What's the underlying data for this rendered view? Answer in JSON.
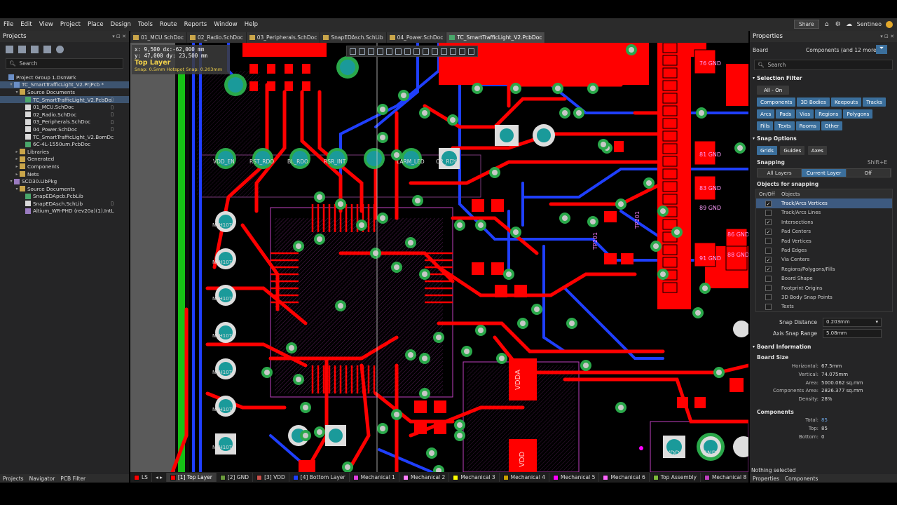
{
  "menubar": {
    "items": [
      "File",
      "Edit",
      "View",
      "Project",
      "Place",
      "Design",
      "Tools",
      "Route",
      "Reports",
      "Window",
      "Help"
    ],
    "share_label": "Share",
    "user": "Sentineo"
  },
  "projects_panel": {
    "title": "Projects",
    "search_placeholder": "Search",
    "tree": [
      {
        "label": "Project Group 1.DsnWrk",
        "icon": "proj",
        "indent": 0,
        "arrow": ""
      },
      {
        "label": "TC_SmartTrafficLight_V2.PrjPcb *",
        "icon": "proj",
        "indent": 1,
        "arrow": "▾",
        "sel": true
      },
      {
        "label": "Source Documents",
        "icon": "folder",
        "indent": 2,
        "arrow": "▾"
      },
      {
        "label": "TC_SmartTrafficLight_V2.PcbDo",
        "icon": "pcb",
        "indent": 3,
        "arrow": "",
        "sel": true,
        "doc": true
      },
      {
        "label": "01_MCU.SchDoc",
        "icon": "sch",
        "indent": 3,
        "arrow": "",
        "doc": true
      },
      {
        "label": "02_Radio.SchDoc",
        "icon": "sch",
        "indent": 3,
        "arrow": "",
        "doc": true
      },
      {
        "label": "03_Peripherals.SchDoc",
        "icon": "sch",
        "indent": 3,
        "arrow": "",
        "doc": true
      },
      {
        "label": "04_Power.SchDoc",
        "icon": "sch",
        "indent": 3,
        "arrow": "",
        "doc": true
      },
      {
        "label": "TC_SmartTrafficLight_V2.BomDc",
        "icon": "sch",
        "indent": 3,
        "arrow": ""
      },
      {
        "label": "6C-4L-1550um.PcbDoc",
        "icon": "pcb",
        "indent": 3,
        "arrow": ""
      },
      {
        "label": "Libraries",
        "icon": "folder",
        "indent": 2,
        "arrow": "▸"
      },
      {
        "label": "Generated",
        "icon": "folder",
        "indent": 2,
        "arrow": "▸"
      },
      {
        "label": "Components",
        "icon": "folder",
        "indent": 2,
        "arrow": "▸"
      },
      {
        "label": "Nets",
        "icon": "folder",
        "indent": 2,
        "arrow": "▸"
      },
      {
        "label": "SCD30.LibPkg",
        "icon": "lib",
        "indent": 1,
        "arrow": "▾"
      },
      {
        "label": "Source Documents",
        "icon": "folder",
        "indent": 2,
        "arrow": "▾"
      },
      {
        "label": "SnapEDApcb.PcbLib",
        "icon": "pcb",
        "indent": 3,
        "arrow": ""
      },
      {
        "label": "SnapEDAsch.SchLib",
        "icon": "sch",
        "indent": 3,
        "arrow": "",
        "doc": true
      },
      {
        "label": "Altium_WR-PHD (rev20a)(1).IntL",
        "icon": "lib",
        "indent": 3,
        "arrow": ""
      }
    ],
    "bottom_tabs": [
      "Projects",
      "Navigator",
      "PCB Filter"
    ]
  },
  "doc_tabs": [
    {
      "label": "01_MCU.SchDoc",
      "kind": "sch"
    },
    {
      "label": "02_Radio.SchDoc",
      "kind": "sch"
    },
    {
      "label": "03_Peripherals.SchDoc",
      "kind": "sch"
    },
    {
      "label": "SnapEDAsch.SchLib",
      "kind": "sch"
    },
    {
      "label": "04_Power.SchDoc",
      "kind": "sch"
    },
    {
      "label": "TC_SmartTrafficLight_V2.PcbDoc",
      "kind": "pcb",
      "active": true
    }
  ],
  "hud": {
    "line1": "x: 9,500  dx:-62,000 mm",
    "line2": "y: 47,000  dy: 23,500 mm",
    "layer": "Top Layer",
    "snap": "Snap: 0.5mm Hotspot Snap: 0.203mm"
  },
  "pcb_labels": {
    "pads_top": [
      "VDD_EN",
      "RST_RDO",
      "BL_RDO",
      "RSR_INT",
      "",
      "LARM_LED",
      "O2_RDY"
    ],
    "pads_left": [
      "NTH1077",
      "NTH1079",
      "NTH1078",
      "NTH1076",
      "NTH1075",
      "NTH1072",
      "NTH1074"
    ],
    "right_gnd": [
      "76 GND",
      "81 GND",
      "83 GND",
      "89 GND",
      "91 GND",
      "86 GND",
      "88 GND",
      "90 GND"
    ],
    "vdda": "VDDA",
    "vdd": "VDD",
    "conn": [
      "VDD",
      "GND"
    ],
    "tp": [
      "TP201",
      "TP201"
    ]
  },
  "layer_bar": [
    {
      "label": "[1] Top Layer",
      "color": "#ff0000",
      "active": true
    },
    {
      "label": "[2] GND",
      "color": "#6a9a3c"
    },
    {
      "label": "[3] VDD",
      "color": "#c9504a"
    },
    {
      "label": "[4] Bottom Layer",
      "color": "#1f3fff"
    },
    {
      "label": "Mechanical 1",
      "color": "#e040e0"
    },
    {
      "label": "Mechanical 2",
      "color": "#ff80ff"
    },
    {
      "label": "Mechanical 3",
      "color": "#ffff00"
    },
    {
      "label": "Mechanical 4",
      "color": "#c9a100"
    },
    {
      "label": "Mechanical 5",
      "color": "#ff00ff"
    },
    {
      "label": "Mechanical 6",
      "color": "#ff66ff"
    },
    {
      "label": "Top Assembly",
      "color": "#7dba3a"
    },
    {
      "label": "Mechanical 8",
      "color": "#c040c0"
    },
    {
      "label": "Mechanical 9",
      "color": "#ff40ff"
    }
  ],
  "layer_bar_ls": "LS",
  "properties": {
    "title": "Properties",
    "board_label": "Board",
    "board_value": "Components (and 12 more)",
    "search_placeholder": "Search",
    "selection_filter_title": "Selection Filter",
    "all_on": "All - On",
    "filter_chips": [
      "Components",
      "3D Bodies",
      "Keepouts",
      "Tracks",
      "Arcs",
      "Pads",
      "Vias",
      "Regions",
      "Polygons",
      "Fills",
      "Texts",
      "Rooms",
      "Other"
    ],
    "snap_options_title": "Snap Options",
    "snap_tabs": [
      "Grids",
      "Guides",
      "Axes"
    ],
    "snapping_label": "Snapping",
    "snapping_shortcut": "Shift+E",
    "snapping_modes": [
      "All Layers",
      "Current Layer",
      "Off"
    ],
    "objects_for_snapping": "Objects for snapping",
    "col_onoff": "On/Off",
    "col_objects": "Objects",
    "snap_objects": [
      {
        "label": "Track/Arcs Vertices",
        "on": true,
        "sel": true
      },
      {
        "label": "Track/Arcs Lines",
        "on": false
      },
      {
        "label": "Intersections",
        "on": true
      },
      {
        "label": "Pad Centers",
        "on": true
      },
      {
        "label": "Pad Vertices",
        "on": false
      },
      {
        "label": "Pad Edges",
        "on": false
      },
      {
        "label": "Via Centers",
        "on": true
      },
      {
        "label": "Regions/Polygons/Fills",
        "on": true
      },
      {
        "label": "Board Shape",
        "on": false
      },
      {
        "label": "Footprint Origins",
        "on": false
      },
      {
        "label": "3D Body Snap Points",
        "on": false
      },
      {
        "label": "Texts",
        "on": false
      }
    ],
    "snap_distance_label": "Snap Distance",
    "snap_distance_value": "0.203mm",
    "axis_snap_range_label": "Axis Snap Range",
    "axis_snap_range_value": "5.08mm",
    "board_info_title": "Board Information",
    "board_size_title": "Board Size",
    "board_size": [
      {
        "k": "Horizontal:",
        "v": "67.5mm"
      },
      {
        "k": "Vertical:",
        "v": "74.075mm"
      },
      {
        "k": "Area:",
        "v": "5000.062 sq.mm"
      },
      {
        "k": "Components Area:",
        "v": "2826.377 sq.mm"
      },
      {
        "k": "Density:",
        "v": "28%"
      }
    ],
    "components_title": "Components",
    "components": [
      {
        "k": "Total:",
        "v": "85",
        "link": true
      },
      {
        "k": "Top:",
        "v": "85"
      },
      {
        "k": "Bottom:",
        "v": "0"
      }
    ],
    "status": "Nothing selected",
    "bottom_tabs": [
      "Properties",
      "Components"
    ]
  },
  "colors": {
    "top_layer": "#ff0000",
    "bottom_layer": "#1f3fff",
    "via_ring": "#2aa84a",
    "pad_teal": "#1a9a9a",
    "silk": "#c040c0",
    "accent": "#3b6f9c"
  }
}
